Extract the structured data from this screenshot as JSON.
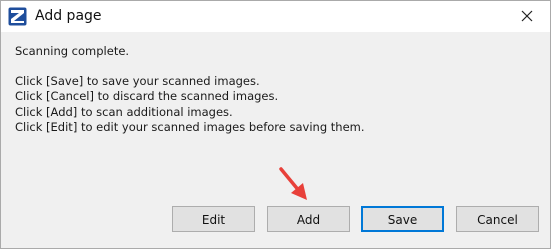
{
  "window": {
    "title": "Add page",
    "icon": "scanner-app-icon",
    "close_icon": "close-icon"
  },
  "message": {
    "status": "Scanning complete.",
    "lines": [
      "Click [Save] to save your scanned images.",
      "Click [Cancel] to discard the scanned images.",
      "Click [Add] to scan additional images.",
      "Click [Edit] to edit your scanned images before saving them."
    ]
  },
  "buttons": {
    "edit": "Edit",
    "add": "Add",
    "save": "Save",
    "cancel": "Cancel",
    "default": "save"
  },
  "colors": {
    "accent": "#0078d7",
    "annotation_arrow": "#e8403a",
    "icon_blue": "#1f4e9c"
  }
}
